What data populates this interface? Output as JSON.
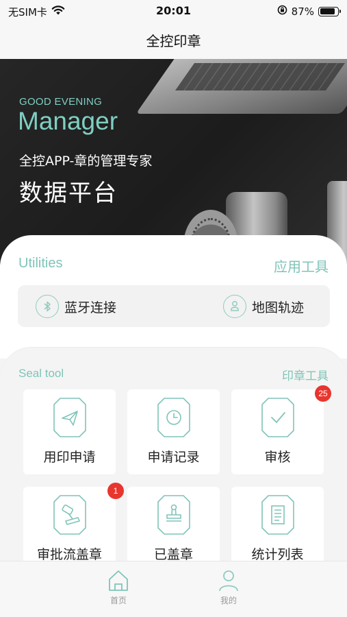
{
  "status_bar": {
    "carrier": "无SIM卡",
    "time": "20:01",
    "battery_percent": "87%",
    "battery_level": 0.87,
    "wifi_icon": "wifi-icon",
    "orientation_lock_icon": "orientation-lock-icon"
  },
  "nav": {
    "title": "全控印章"
  },
  "banner": {
    "greeting": "GOOD EVENING",
    "role": "Manager",
    "subtitle": "全控APP-章的管理专家",
    "title": "数据平台"
  },
  "utilities": {
    "title_en": "Utilities",
    "title_zh": "应用工具",
    "items": [
      {
        "label": "蓝牙连接",
        "icon": "bluetooth-icon"
      },
      {
        "label": "地图轨迹",
        "icon": "map-track-icon"
      }
    ]
  },
  "seal_tool": {
    "title_en": "Seal tool",
    "title_zh": "印章工具",
    "tiles": [
      {
        "label": "用印申请",
        "icon": "send-icon",
        "badge": ""
      },
      {
        "label": "申请记录",
        "icon": "clock-icon",
        "badge": ""
      },
      {
        "label": "审核",
        "icon": "check-icon",
        "badge": "25"
      },
      {
        "label": "审批流盖章",
        "icon": "stamp-approve-icon",
        "badge": "1"
      },
      {
        "label": "已盖章",
        "icon": "stamp-icon",
        "badge": ""
      },
      {
        "label": "统计列表",
        "icon": "list-icon",
        "badge": ""
      }
    ]
  },
  "tab_bar": {
    "tabs": [
      {
        "label": "首页",
        "icon": "home-icon",
        "active": true
      },
      {
        "label": "我的",
        "icon": "profile-icon",
        "active": false
      }
    ]
  },
  "colors": {
    "accent": "#7fc4b8",
    "badge": "#e8352e",
    "banner_bg": "#222222"
  }
}
